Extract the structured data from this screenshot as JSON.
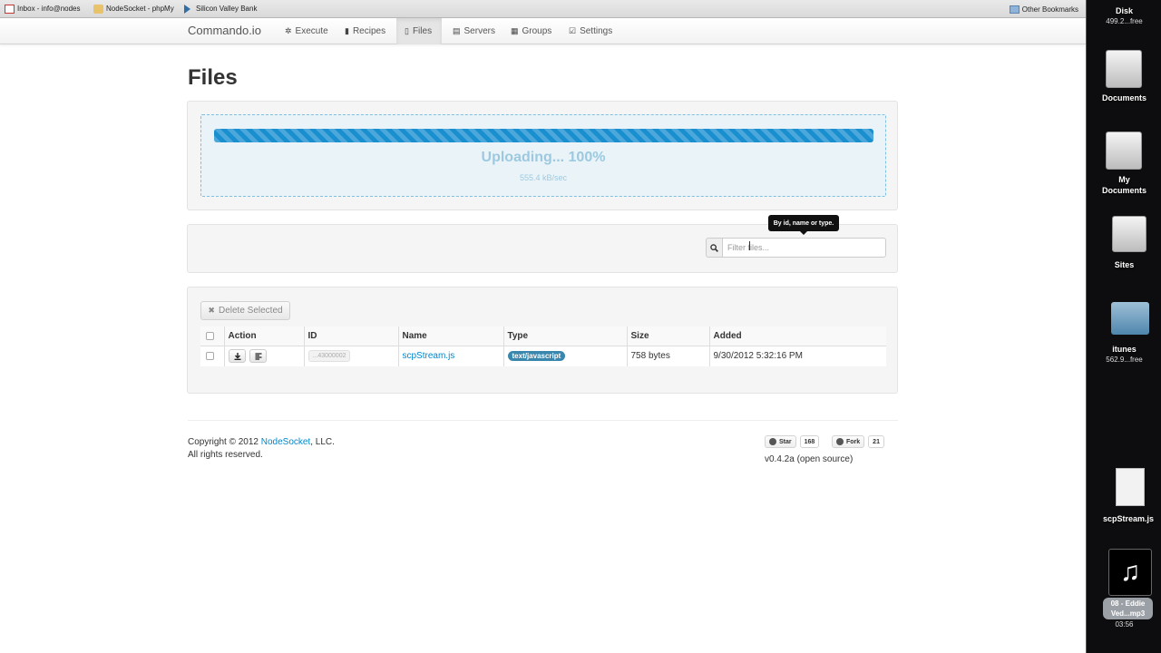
{
  "bookmarks": {
    "items": [
      {
        "label": "Inbox - info@nodes",
        "icon": "gmail-icon"
      },
      {
        "label": "NodeSocket - phpMy",
        "icon": "phpmyadmin-icon"
      },
      {
        "label": "Silicon Valley Bank",
        "icon": "svb-icon"
      }
    ],
    "other": "Other Bookmarks"
  },
  "navbar": {
    "brand": "Commando.io",
    "items": [
      {
        "label": "Execute",
        "icon": "gear-icon"
      },
      {
        "label": "Recipes",
        "icon": "book-icon"
      },
      {
        "label": "Files",
        "icon": "file-icon",
        "active": true
      },
      {
        "label": "Servers",
        "icon": "server-icon"
      },
      {
        "label": "Groups",
        "icon": "grid-icon"
      },
      {
        "label": "Settings",
        "icon": "check-icon"
      }
    ]
  },
  "page": {
    "title": "Files"
  },
  "upload": {
    "progress_percent": 100,
    "status": "Uploading... 100%",
    "speed": "555.4 kB/sec",
    "bar_color": "#1a8fd0"
  },
  "filter": {
    "placeholder": "Filter files...",
    "tooltip": "By id, name or type."
  },
  "files": {
    "delete_button": "Delete Selected",
    "columns": [
      "Action",
      "ID",
      "Name",
      "Type",
      "Size",
      "Added"
    ],
    "rows": [
      {
        "id": "...43000002",
        "name": "scpStream.js",
        "type": "text/javascript",
        "size": "758 bytes",
        "added": "9/30/2012 5:32:16 PM"
      }
    ]
  },
  "footer": {
    "copyright_prefix": "Copyright © 2012 ",
    "company_link": "NodeSocket",
    "copyright_suffix": ", LLC.",
    "rights": "All rights reserved.",
    "star_label": "Star",
    "star_count": "168",
    "fork_label": "Fork",
    "fork_count": "21",
    "version": "v0.4.2a (open source)"
  },
  "desktop": {
    "disk_label": "Disk",
    "disk_free": "499.2...free",
    "items": [
      {
        "label": "Documents"
      },
      {
        "label": "My Documents"
      },
      {
        "label": "Sites"
      },
      {
        "label": "itunes",
        "sub": "562.9...free"
      },
      {
        "label": "scpStream.js"
      },
      {
        "label": "08 - Eddie Ved...mp3",
        "sub": "03:56"
      }
    ]
  },
  "colors": {
    "link": "#0088cc",
    "type_badge": "#3a87ad",
    "upload_text": "#9cc9e0"
  }
}
